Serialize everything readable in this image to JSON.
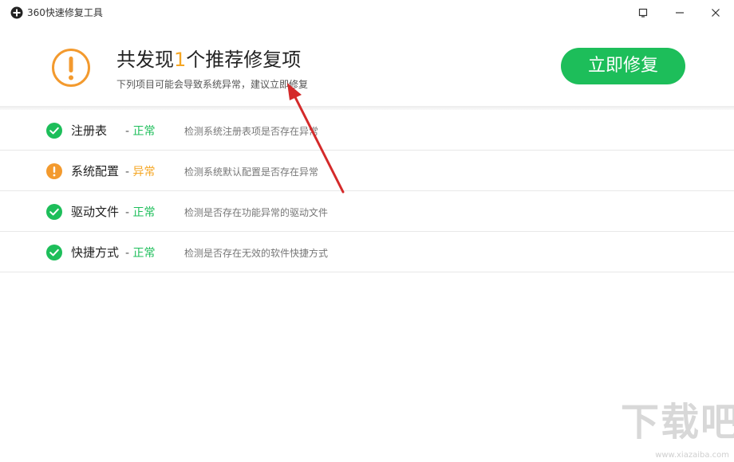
{
  "window": {
    "title": "360快速修复工具"
  },
  "header": {
    "headline_prefix": "共发现",
    "headline_count": "1",
    "headline_suffix": "个推荐修复项",
    "subtitle": "下列项目可能会导致系统异常，建议立即修复",
    "fix_button_label": "立即修复"
  },
  "items": [
    {
      "name": "注册表",
      "status": "正常",
      "status_kind": "ok",
      "description": "检测系统注册表项是否存在异常"
    },
    {
      "name": "系统配置",
      "status": "异常",
      "status_kind": "warning",
      "description": "检测系统默认配置是否存在异常"
    },
    {
      "name": "驱动文件",
      "status": "正常",
      "status_kind": "ok",
      "description": "检测是否存在功能异常的驱动文件"
    },
    {
      "name": "快捷方式",
      "status": "正常",
      "status_kind": "ok",
      "description": "检测是否存在无效的软件快捷方式"
    }
  ],
  "status_dash": "-",
  "colors": {
    "accent_green": "#1dbe5a",
    "warning_orange": "#f5a623",
    "annotation_red": "#d42a2a"
  },
  "icons": {
    "app": "360-logo-icon",
    "headline": "exclamation-circle-icon",
    "ok": "check-circle-icon",
    "warning": "exclamation-circle-icon"
  },
  "watermark": {
    "main": "下载吧",
    "sub": "www.xiazaiba.com"
  }
}
